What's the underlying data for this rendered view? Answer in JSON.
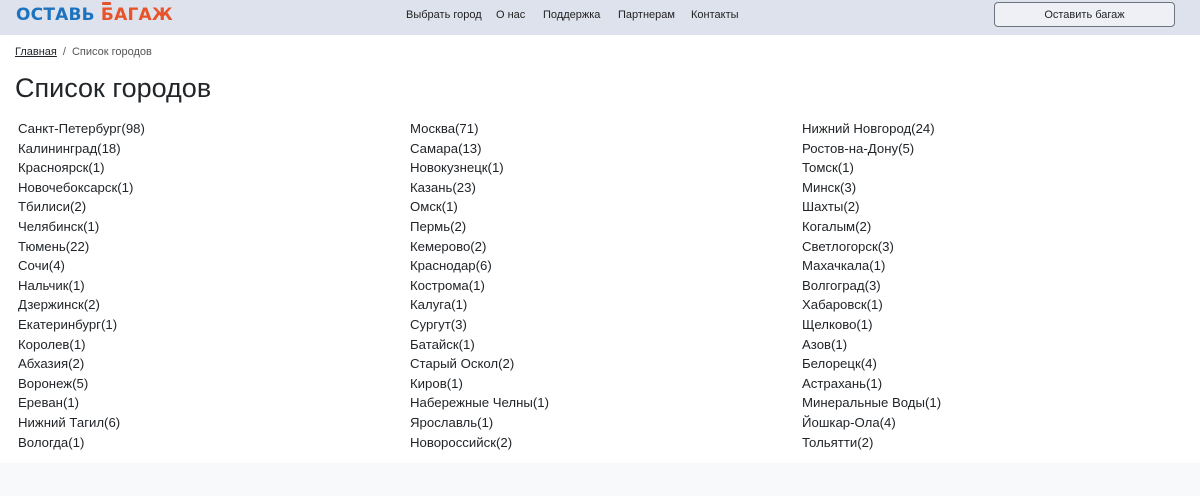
{
  "header": {
    "logo_part1": "ОСТАВЬ",
    "logo_part2_first": "Б",
    "logo_part2_rest": "АГАЖ",
    "nav": [
      "Выбрать город",
      "О нас",
      "Поддержка",
      "Партнерам",
      "Контакты"
    ],
    "cta_label": "Оставить багаж"
  },
  "breadcrumb": {
    "home": "Главная",
    "separator": "/",
    "current": "Список городов"
  },
  "page_title": "Список городов",
  "colors": {
    "header_bg": "#dee2ec",
    "logo_blue": "#1e73be",
    "logo_orange": "#e8542a",
    "footer_bg": "#f8f9fa"
  },
  "cities": {
    "col1": [
      "Санкт-Петербург(98)",
      "Калининград(18)",
      "Красноярск(1)",
      "Новочебоксарск(1)",
      "Тбилиси(2)",
      "Челябинск(1)",
      "Тюмень(22)",
      "Сочи(4)",
      "Нальчик(1)",
      "Дзержинск(2)",
      "Екатеринбург(1)",
      "Королев(1)",
      "Абхазия(2)",
      "Воронеж(5)",
      "Ереван(1)",
      "Нижний Тагил(6)",
      "Вологда(1)"
    ],
    "col2": [
      "Москва(71)",
      "Самара(13)",
      "Новокузнецк(1)",
      "Казань(23)",
      "Омск(1)",
      "Пермь(2)",
      "Кемерово(2)",
      "Краснодар(6)",
      "Кострома(1)",
      "Калуга(1)",
      "Сургут(3)",
      "Батайск(1)",
      "Старый Оскол(2)",
      "Киров(1)",
      "Набережные Челны(1)",
      "Ярославль(1)",
      "Новороссийск(2)"
    ],
    "col3": [
      "Нижний Новгород(24)",
      "Ростов-на-Дону(5)",
      "Томск(1)",
      "Минск(3)",
      "Шахты(2)",
      "Когалым(2)",
      "Светлогорск(3)",
      "Махачкала(1)",
      "Волгоград(3)",
      "Хабаровск(1)",
      "Щелково(1)",
      "Азов(1)",
      "Белорецк(4)",
      "Астрахань(1)",
      "Минеральные Воды(1)",
      "Йошкар-Ола(4)",
      "Тольятти(2)"
    ]
  }
}
